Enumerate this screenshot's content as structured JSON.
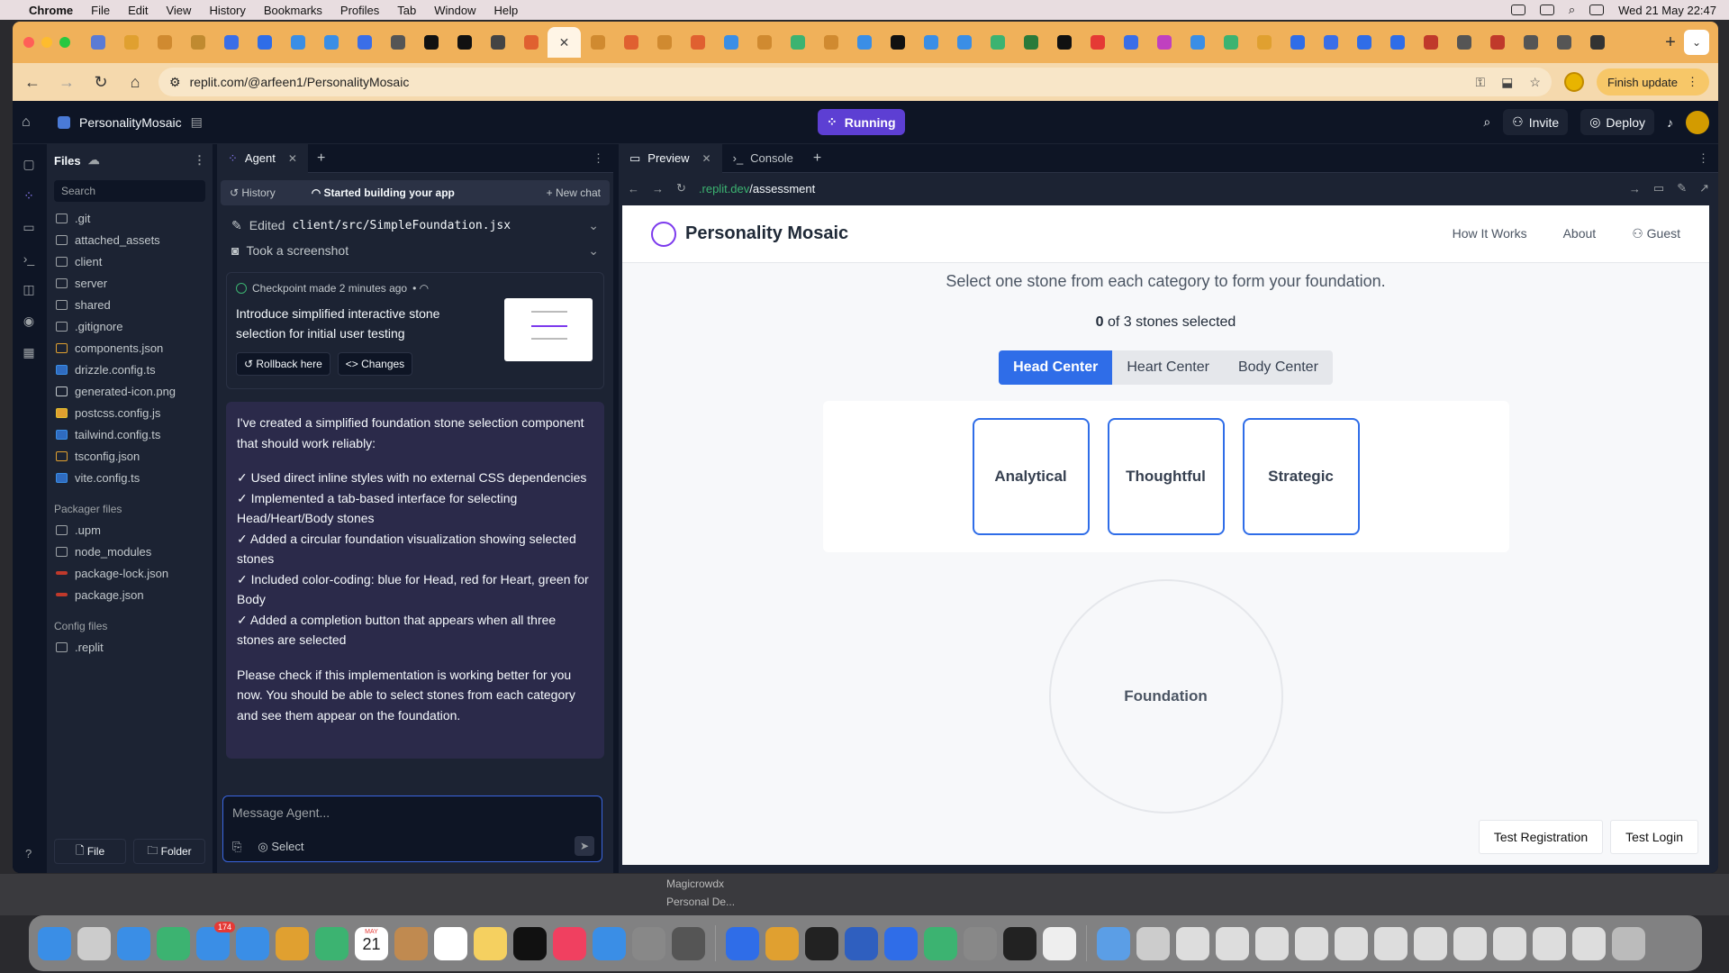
{
  "menubar": {
    "app": "Chrome",
    "items": [
      "File",
      "Edit",
      "View",
      "History",
      "Bookmarks",
      "Profiles",
      "Tab",
      "Window",
      "Help"
    ],
    "datetime": "Wed 21 May  22:47"
  },
  "browser": {
    "url": "replit.com/@arfeen1/PersonalityMosaic",
    "finish_update": "Finish update"
  },
  "replit": {
    "project_name": "PersonalityMosaic",
    "run_status": "Running",
    "invite": "Invite",
    "deploy": "Deploy"
  },
  "files": {
    "title": "Files",
    "search_placeholder": "Search",
    "items": [
      ".git",
      "attached_assets",
      "client",
      "server",
      "shared",
      ".gitignore",
      "components.json",
      "drizzle.config.ts",
      "generated-icon.png",
      "postcss.config.js",
      "tailwind.config.ts",
      "tsconfig.json",
      "vite.config.ts"
    ],
    "packager_title": "Packager files",
    "packager_items": [
      ".upm",
      "node_modules",
      "package-lock.json",
      "package.json"
    ],
    "config_title": "Config files",
    "config_items": [
      ".replit"
    ],
    "new_file": "File",
    "new_folder": "Folder"
  },
  "agent": {
    "tab": "Agent",
    "history": "History",
    "status": "Started building your app",
    "new_chat": "New chat",
    "edited_label": "Edited",
    "edited_file": "client/src/SimpleFoundation.jsx",
    "screenshot": "Took a screenshot",
    "checkpoint_head": "Checkpoint made 2 minutes ago",
    "checkpoint_title": "Introduce simplified interactive stone selection for initial user testing",
    "rollback": "Rollback here",
    "changes": "Changes",
    "message_intro": "I've created a simplified foundation stone selection component that should work reliably:",
    "message_points": [
      "✓ Used direct inline styles with no external CSS dependencies",
      "✓ Implemented a tab-based interface for selecting Head/Heart/Body stones",
      "✓ Added a circular foundation visualization showing selected stones",
      "✓ Included color-coding: blue for Head, red for Heart, green for Body",
      "✓ Added a completion button that appears when all three stones are selected"
    ],
    "message_outro": "Please check if this implementation is working better for you now. You should be able to select stones from each category and see them appear on the foundation.",
    "composer_placeholder": "Message Agent...",
    "select": "Select"
  },
  "preview": {
    "tab": "Preview",
    "console_tab": "Console",
    "url_domain": ".replit.dev",
    "url_path": "/assessment"
  },
  "site": {
    "brand": "Personality Mosaic",
    "nav": [
      "How It Works",
      "About",
      "Guest"
    ],
    "subtitle": "Select one stone from each category to form your foundation.",
    "count_num": "0",
    "count_text": " of 3 stones selected",
    "categories": [
      "Head Center",
      "Heart Center",
      "Body Center"
    ],
    "stones": [
      "Analytical",
      "Thoughtful",
      "Strategic"
    ],
    "foundation": "Foundation",
    "test_registration": "Test Registration",
    "test_login": "Test Login"
  },
  "background": {
    "text_a": "Magicrowdx",
    "text_b": "Personal De..."
  },
  "dock": {
    "calendar_day": "21",
    "calendar_month": "MAY",
    "mail_badge": "174"
  }
}
